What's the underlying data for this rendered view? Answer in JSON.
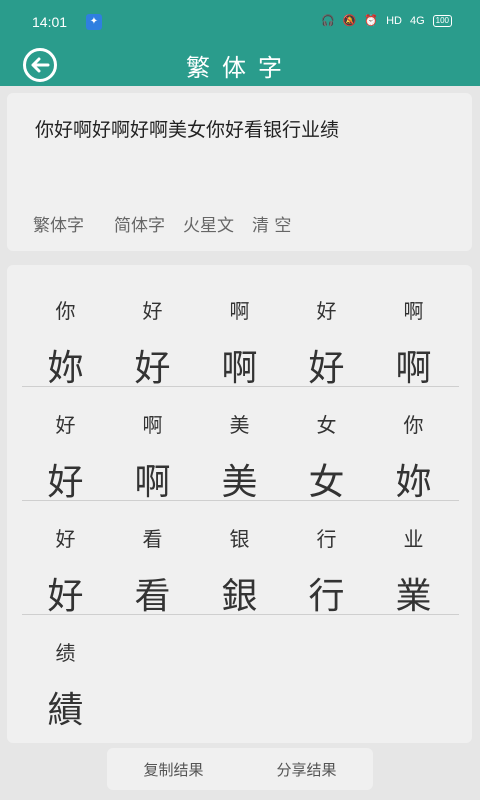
{
  "status_bar": {
    "time": "14:01",
    "app_icon": "app-notification-icon",
    "network_label": "HD",
    "signal_label": "4G",
    "battery": "100"
  },
  "header": {
    "title": "繁体字",
    "back_icon": "back-arrow-icon",
    "bg_color": "#2a9c8c"
  },
  "input": {
    "text": "你好啊好啊好啊美女你好看银行业绩"
  },
  "modes": [
    {
      "label": "繁体字"
    },
    {
      "label": "简体字"
    },
    {
      "label": "火星文"
    },
    {
      "label": "清 空"
    }
  ],
  "results": [
    [
      {
        "simp": "你",
        "trad": "妳"
      },
      {
        "simp": "好",
        "trad": "好"
      },
      {
        "simp": "啊",
        "trad": "啊"
      },
      {
        "simp": "好",
        "trad": "好"
      },
      {
        "simp": "啊",
        "trad": "啊"
      }
    ],
    [
      {
        "simp": "好",
        "trad": "好"
      },
      {
        "simp": "啊",
        "trad": "啊"
      },
      {
        "simp": "美",
        "trad": "美"
      },
      {
        "simp": "女",
        "trad": "女"
      },
      {
        "simp": "你",
        "trad": "妳"
      }
    ],
    [
      {
        "simp": "好",
        "trad": "好"
      },
      {
        "simp": "看",
        "trad": "看"
      },
      {
        "simp": "银",
        "trad": "銀"
      },
      {
        "simp": "行",
        "trad": "行"
      },
      {
        "simp": "业",
        "trad": "業"
      }
    ],
    [
      {
        "simp": "绩",
        "trad": "績"
      }
    ]
  ],
  "actions": {
    "copy": "复制结果",
    "share": "分享结果"
  }
}
